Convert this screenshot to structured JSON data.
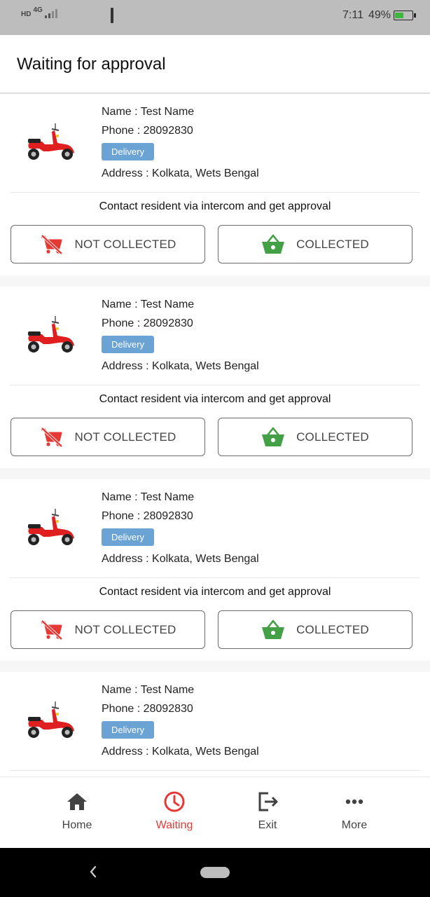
{
  "statusbar": {
    "network": "4G",
    "hd": "HD",
    "time": "7:11",
    "battery": "49%"
  },
  "header": {
    "title": "Waiting for approval"
  },
  "cards": [
    {
      "name": "Name : Test Name",
      "phone": "Phone : 28092830",
      "badge": "Delivery",
      "address": "Address : Kolkata, Wets Bengal",
      "contact": "Contact resident via intercom and get approval",
      "not_collected": "NOT COLLECTED",
      "collected": "COLLECTED"
    },
    {
      "name": "Name : Test Name",
      "phone": "Phone : 28092830",
      "badge": "Delivery",
      "address": "Address : Kolkata, Wets Bengal",
      "contact": "Contact resident via intercom and get approval",
      "not_collected": "NOT COLLECTED",
      "collected": "COLLECTED"
    },
    {
      "name": "Name : Test Name",
      "phone": "Phone : 28092830",
      "badge": "Delivery",
      "address": "Address : Kolkata, Wets Bengal",
      "contact": "Contact resident via intercom and get approval",
      "not_collected": "NOT COLLECTED",
      "collected": "COLLECTED"
    },
    {
      "name": "Name : Test Name",
      "phone": "Phone : 28092830",
      "badge": "Delivery",
      "address": "Address : Kolkata, Wets Bengal"
    }
  ],
  "nav": {
    "home": "Home",
    "waiting": "Waiting",
    "exit": "Exit",
    "more": "More",
    "active": "waiting"
  },
  "colors": {
    "accent_red": "#e53935",
    "collected_green": "#43a047",
    "badge_blue": "#6aa3d4"
  },
  "icons": {
    "vehicle": "scooter-icon",
    "not_collected": "cart-off-icon",
    "collected": "basket-icon",
    "home": "home-icon",
    "waiting": "clock-icon",
    "exit": "exit-icon",
    "more": "more-dots-icon"
  }
}
